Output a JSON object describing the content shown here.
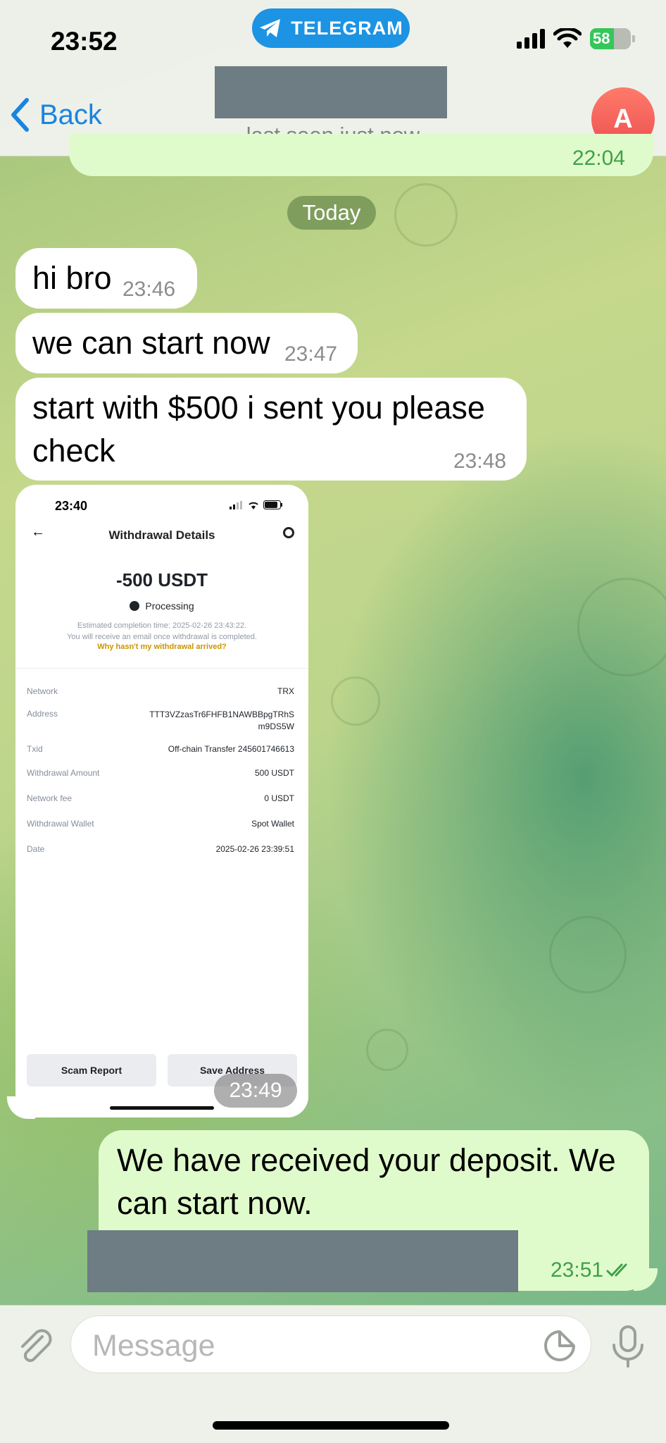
{
  "status_bar": {
    "time": "23:52",
    "app_pill": "TELEGRAM",
    "battery": "58"
  },
  "header": {
    "back_label": "Back",
    "last_seen": "last seen just now",
    "avatar_letter": "A"
  },
  "chat": {
    "previous_time": "22:04",
    "date_separator": "Today",
    "messages": [
      {
        "text": "hi bro",
        "time": "23:46"
      },
      {
        "text": "we can start now",
        "time": "23:47"
      },
      {
        "text": "start with $500 i sent you please check",
        "time": "23:48"
      }
    ],
    "image_message": {
      "time": "23:49",
      "screenshot": {
        "time": "23:40",
        "title": "Withdrawal Details",
        "amount": "-500 USDT",
        "status": "Processing",
        "note_line1": "Estimated completion time: 2025-02-26 23:43:22.",
        "note_line2": "You will receive an email once withdrawal is completed.",
        "why_link": "Why hasn't my withdrawal arrived?",
        "rows": [
          {
            "key": "Network",
            "value": "TRX"
          },
          {
            "key": "Address",
            "value": "TTT3VZzasTr6FHFB1NAWBBpgTRhS m9DS5W"
          },
          {
            "key": "Txid",
            "value": "Off-chain Transfer 245601746613"
          },
          {
            "key": "Withdrawal Amount",
            "value": "500 USDT"
          },
          {
            "key": "Network fee",
            "value": "0 USDT"
          },
          {
            "key": "Withdrawal Wallet",
            "value": "Spot Wallet"
          },
          {
            "key": "Date",
            "value": "2025-02-26 23:39:51"
          }
        ],
        "button_left": "Scam Report",
        "button_right": "Save Address"
      }
    },
    "outgoing": {
      "text": "We have received your deposit. We can start now.",
      "time": "23:51"
    }
  },
  "input": {
    "placeholder": "Message"
  },
  "colors": {
    "accent": "#1a84e0",
    "outgoing_bubble": "#e0fbcb",
    "incoming_bubble": "#ffffff",
    "pill": "#1c93e3"
  }
}
